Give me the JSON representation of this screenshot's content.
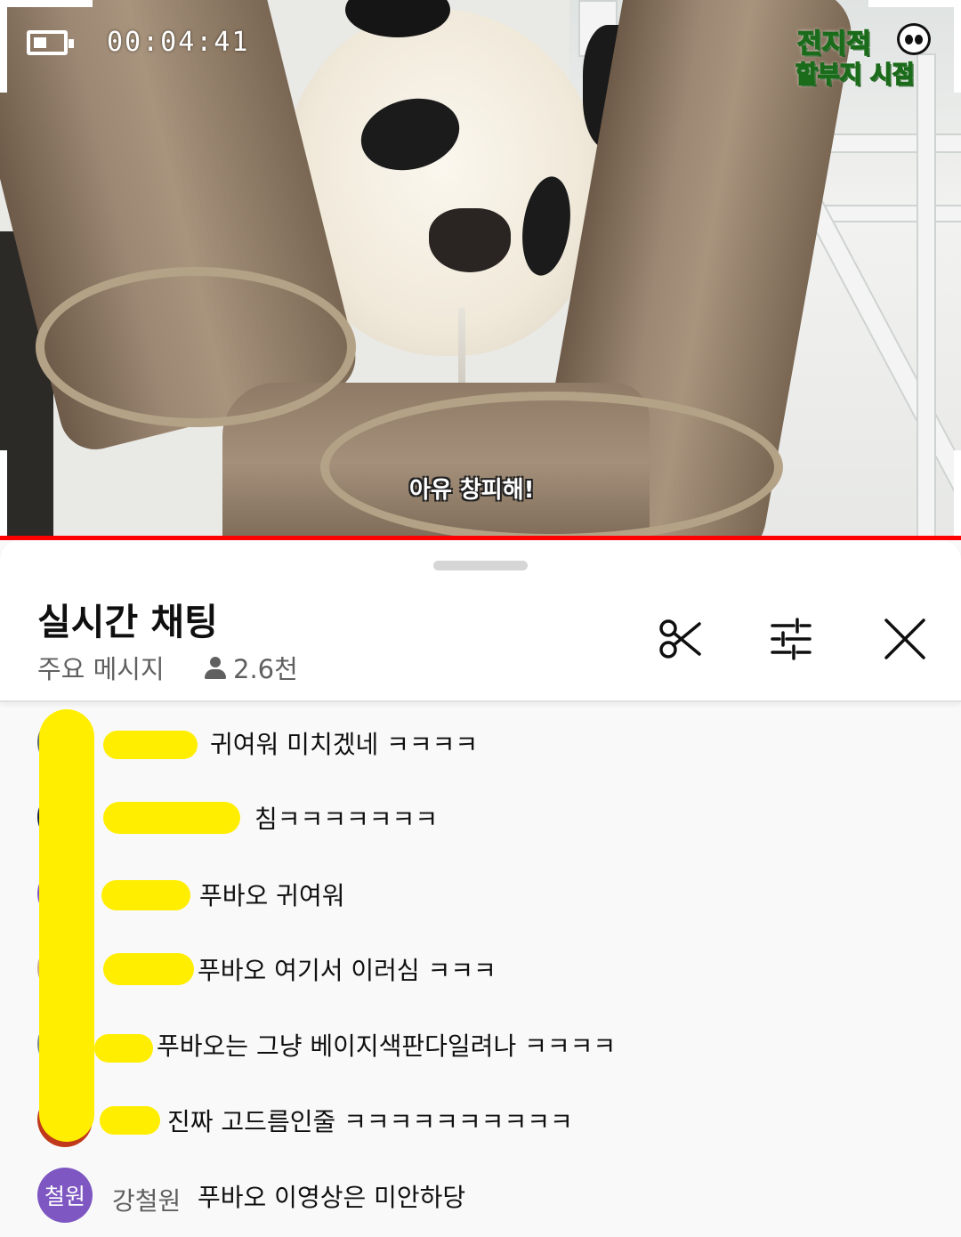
{
  "video": {
    "rec_time": "00:04:41",
    "brand_line1": "전지적",
    "brand_line2": "할부지 시점",
    "subtitle": "아유 창피해!",
    "accent_color": "#ff0000"
  },
  "chat": {
    "title": "실시간 채팅",
    "filter_label": "주요 메시지",
    "viewer_count": "2.6천",
    "icons": [
      "scissors-icon",
      "tune-icon",
      "close-icon"
    ]
  },
  "messages": [
    {
      "author": "",
      "text": "귀여워 미치겠네 ㅋㅋㅋㅋ",
      "avatar_color": "#5d6b73"
    },
    {
      "author": "",
      "text": "침ㅋㅋㅋㅋㅋㅋㅋ",
      "avatar_color": "#1b2442"
    },
    {
      "author": "",
      "text": "푸바오 귀여워",
      "avatar_color": "#7e57c2"
    },
    {
      "author": "",
      "text": "푸바오 여기서 이러심 ㅋㅋㅋ",
      "avatar_color": "#c9a98a"
    },
    {
      "author": "",
      "text": "푸바오는 그냥 베이지색판다일려나 ㅋㅋㅋㅋ",
      "avatar_color": "#7a8a8c"
    },
    {
      "author": "",
      "text": "진짜 고드름인줄 ㅋㅋㅋㅋㅋㅋㅋㅋㅋㅋ",
      "avatar_color": "#c0391b"
    },
    {
      "author": "강철원",
      "text": "푸바오 이영상은 미안하당",
      "avatar_text": "철원",
      "avatar_color": "#7e57c2"
    }
  ]
}
